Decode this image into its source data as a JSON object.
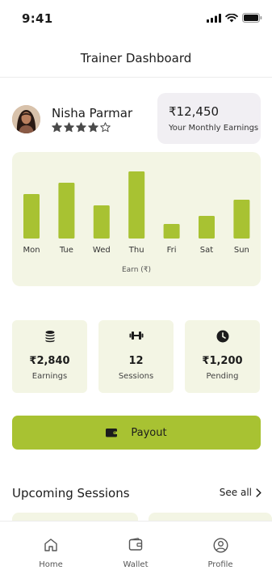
{
  "status_bar": {
    "time": "9:41"
  },
  "header": {
    "title": "Trainer Dashboard"
  },
  "profile": {
    "name": "Nisha Parmar",
    "rating": 4,
    "max_rating": 5
  },
  "earnings_card": {
    "amount": "₹12,450",
    "label": "Your Monthly Earnings"
  },
  "chart_data": {
    "type": "bar",
    "categories": [
      "Mon",
      "Tue",
      "Wed",
      "Thu",
      "Fri",
      "Sat",
      "Sun"
    ],
    "values": [
      55,
      69,
      41,
      83,
      18,
      28,
      48
    ],
    "xlabel": "Earn (₹)",
    "bar_color": "#a8c232"
  },
  "stats": [
    {
      "icon": "coins-icon",
      "value": "₹2,840",
      "label": "Earnings"
    },
    {
      "icon": "dumbbell-icon",
      "value": "12",
      "label": "Sessions"
    },
    {
      "icon": "clock-icon",
      "value": "₹1,200",
      "label": "Pending"
    }
  ],
  "payout": {
    "label": "Payout",
    "icon": "wallet-icon"
  },
  "upcoming": {
    "title": "Upcoming Sessions",
    "see_all": "See all"
  },
  "nav": [
    {
      "icon": "home-icon",
      "label": "Home"
    },
    {
      "icon": "wallet-icon",
      "label": "Wallet"
    },
    {
      "icon": "profile-icon",
      "label": "Profile"
    }
  ],
  "colors": {
    "accent": "#a8c232",
    "card_tint": "#f3f5e4",
    "earnings_card": "#f1eff3"
  }
}
